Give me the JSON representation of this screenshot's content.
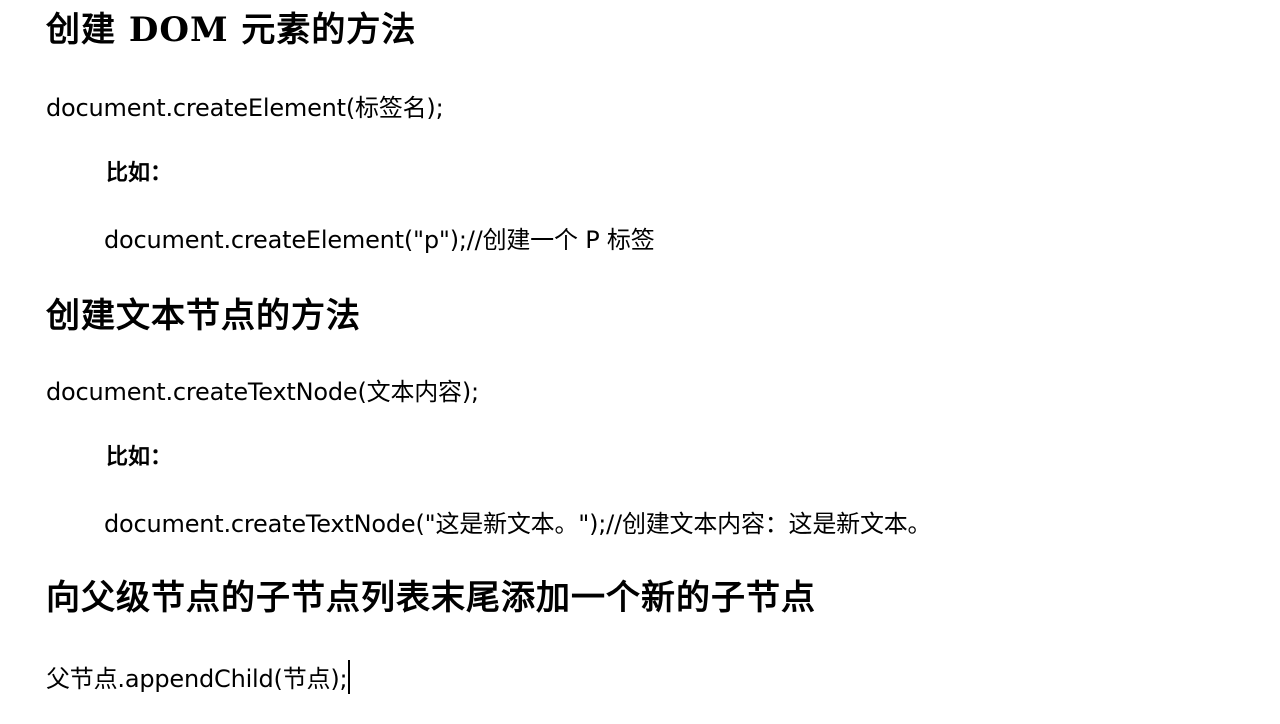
{
  "sections": [
    {
      "heading": "创建 DOM 元素的方法",
      "syntax": "document.createElement(标签名);",
      "example_label": "比如：",
      "example": "document.createElement(\"p\");//创建一个 P 标签"
    },
    {
      "heading": "创建文本节点的方法",
      "syntax": "document.createTextNode(文本内容);",
      "example_label": "比如：",
      "example": "document.createTextNode(\"这是新文本。\");//创建文本内容：这是新文本。"
    },
    {
      "heading": "向父级节点的子节点列表末尾添加一个新的子节点",
      "syntax": "父节点.appendChild(节点);"
    }
  ]
}
